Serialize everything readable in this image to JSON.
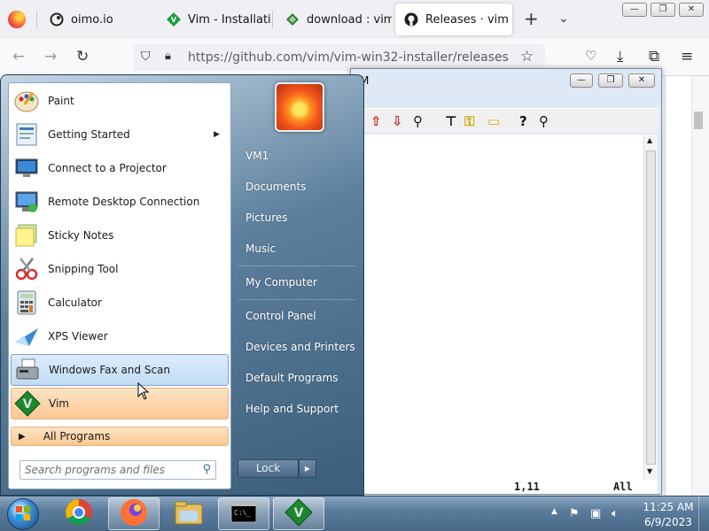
{
  "browser": {
    "tabs": [
      {
        "label": "oimo.io",
        "icon": "oimo-icon"
      },
      {
        "label": "Vim - Installation",
        "icon": "vim-icon"
      },
      {
        "label": "download : vim",
        "icon": "download-icon"
      },
      {
        "label": "Releases · vim",
        "icon": "github-icon"
      }
    ],
    "url": "https://github.com/vim/vim-win32-installer/releases"
  },
  "vim": {
    "title_fragment": "M",
    "status_pos": "1,11",
    "status_scroll": "All"
  },
  "start_menu": {
    "programs": [
      {
        "label": "Paint",
        "icon": "paint-icon"
      },
      {
        "label": "Getting Started",
        "icon": "getting-started-icon",
        "submenu": true
      },
      {
        "label": "Connect to a Projector",
        "icon": "projector-icon"
      },
      {
        "label": "Remote Desktop Connection",
        "icon": "remote-desktop-icon"
      },
      {
        "label": "Sticky Notes",
        "icon": "sticky-notes-icon"
      },
      {
        "label": "Snipping Tool",
        "icon": "snipping-tool-icon"
      },
      {
        "label": "Calculator",
        "icon": "calculator-icon"
      },
      {
        "label": "XPS Viewer",
        "icon": "xps-viewer-icon"
      },
      {
        "label": "Windows Fax and Scan",
        "icon": "fax-scan-icon",
        "state": "hover"
      },
      {
        "label": "Vim",
        "icon": "vim-icon",
        "state": "new"
      }
    ],
    "all_programs": "All Programs",
    "search_placeholder": "Search programs and files",
    "places": [
      "VM1",
      "Documents",
      "Pictures",
      "Music",
      "My Computer",
      "Control Panel",
      "Devices and Printers",
      "Default Programs",
      "Help and Support"
    ],
    "lock_label": "Lock"
  },
  "taskbar": {
    "items": [
      "chrome-icon",
      "firefox-icon",
      "explorer-icon",
      "cmd-icon",
      "vim-icon"
    ],
    "clock_time": "11:25 AM",
    "clock_date": "6/9/2023"
  },
  "colors": {
    "hover_blue": "#c1dcf3",
    "new_program_orange": "#fbc894",
    "start_menu_blue": "#3b5e7b"
  }
}
